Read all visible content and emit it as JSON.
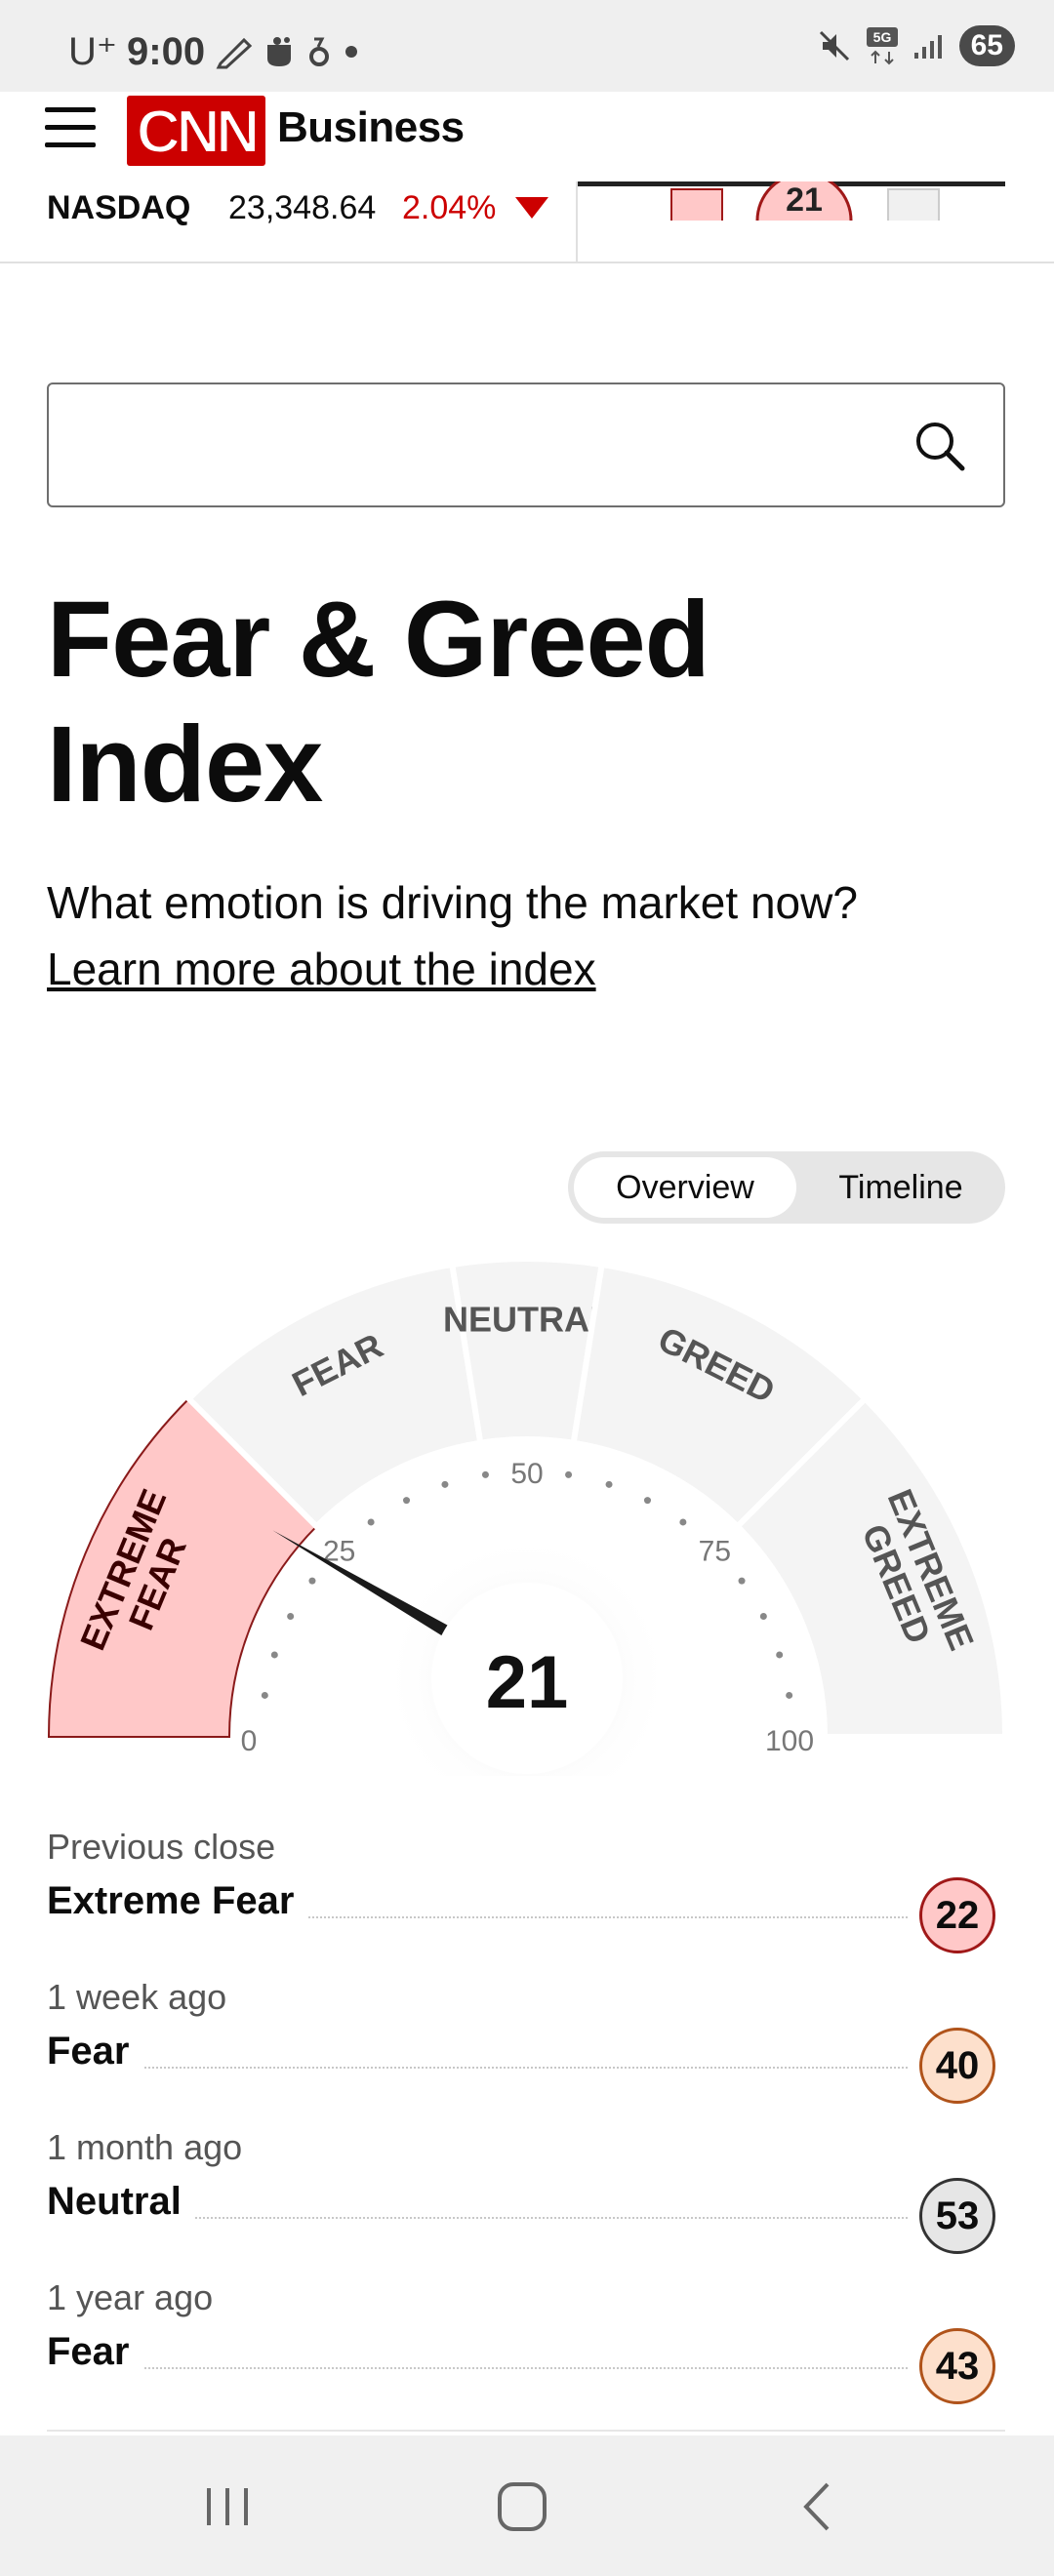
{
  "status_bar": {
    "carrier": "U⁺",
    "time": "9:00",
    "network": "5G",
    "battery": "65",
    "icons": [
      "pen-icon",
      "cup-icon",
      "nfc-icon",
      "dot-icon",
      "mute-icon",
      "5g-icon",
      "signal-icon",
      "battery-icon"
    ]
  },
  "header": {
    "logo": "CNN",
    "section": "Business",
    "menu_icon": "hamburger-menu-icon"
  },
  "ticker": {
    "name": "NASDAQ",
    "value": "23,348.64",
    "change": "2.04%",
    "direction": "down",
    "change_color": "#cc0000",
    "mini_gauge_value": "21"
  },
  "search": {
    "placeholder": "",
    "icon": "search-icon"
  },
  "page": {
    "title": "Fear & Greed Index",
    "subtitle": "What emotion is driving the market now?",
    "learn_more": "Learn more about the index"
  },
  "view_toggle": {
    "options": [
      "Overview",
      "Timeline"
    ],
    "selected": "Overview"
  },
  "gauge": {
    "value": 21,
    "current_label": "Extreme Fear",
    "segments": [
      {
        "label": "EXTREME FEAR",
        "range": [
          0,
          25
        ]
      },
      {
        "label": "FEAR",
        "range": [
          25,
          45
        ]
      },
      {
        "label": "NEUTRAL",
        "range": [
          45,
          55
        ]
      },
      {
        "label": "GREED",
        "range": [
          55,
          75
        ]
      },
      {
        "label": "EXTREME GREED",
        "range": [
          75,
          100
        ]
      }
    ],
    "scale_labels": [
      "0",
      "25",
      "50",
      "75",
      "100"
    ],
    "active_color": "#ffc8c8",
    "active_border": "#8a1a1a",
    "inactive_color": "#f4f4f4"
  },
  "history": [
    {
      "when": "Previous close",
      "rating": "Extreme Fear",
      "value": "22",
      "bg": "#ffc8c8",
      "border": "#a01818"
    },
    {
      "when": "1 week ago",
      "rating": "Fear",
      "value": "40",
      "bg": "#fde0cc",
      "border": "#b0531a"
    },
    {
      "when": "1 month ago",
      "rating": "Neutral",
      "value": "53",
      "bg": "#e6e6e6",
      "border": "#333333"
    },
    {
      "when": "1 year ago",
      "rating": "Fear",
      "value": "43",
      "bg": "#fde0cc",
      "border": "#b0531a"
    }
  ],
  "nav_bar": {
    "buttons": [
      "recent-apps-icon",
      "home-icon",
      "back-icon"
    ]
  }
}
